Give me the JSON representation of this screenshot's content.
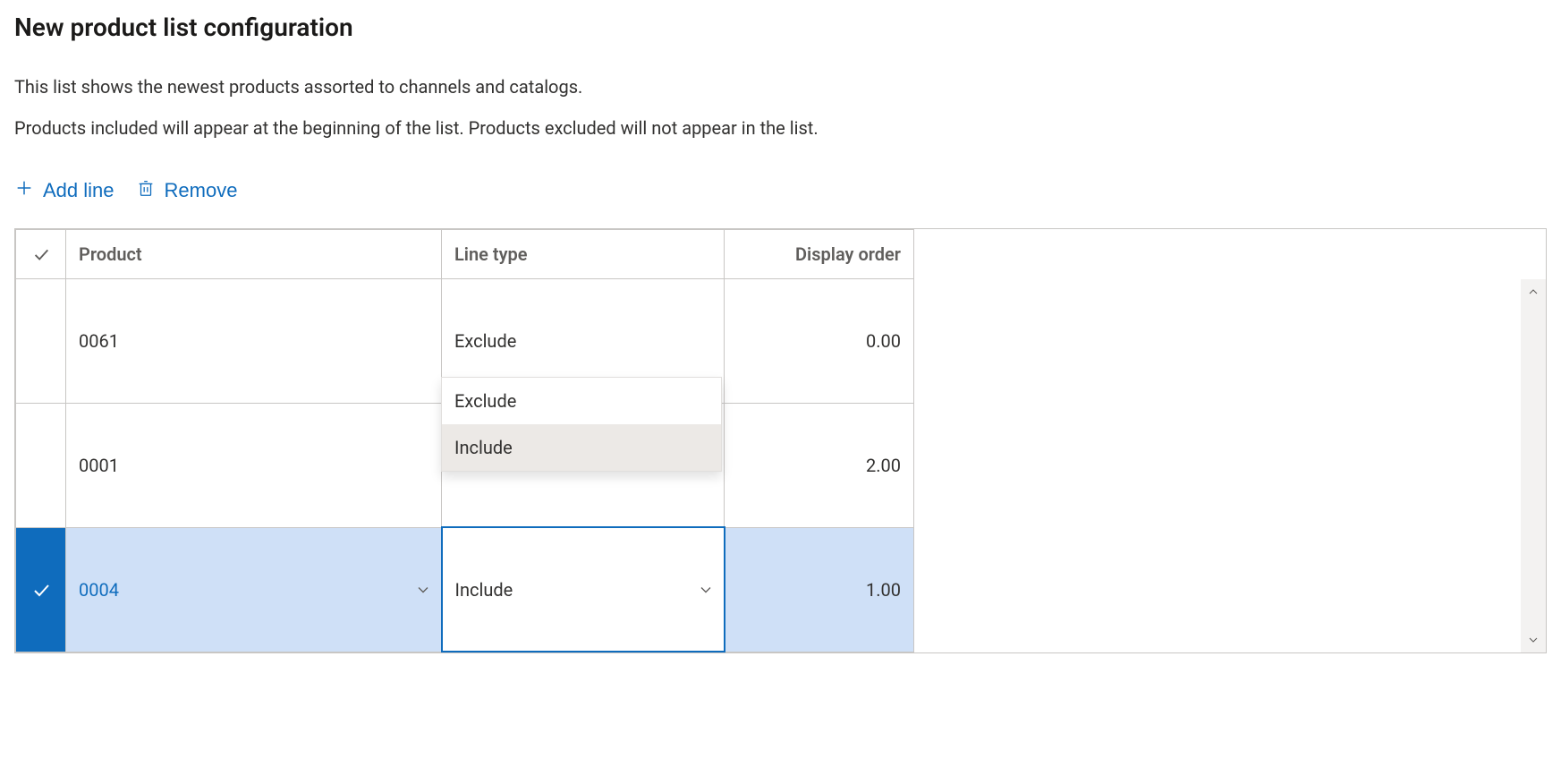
{
  "title": "New product list configuration",
  "description_line1": "This list shows the newest products assorted to channels and catalogs.",
  "description_line2": "Products included will appear at the beginning of the list. Products excluded will not appear in the list.",
  "toolbar": {
    "add_label": "Add line",
    "remove_label": "Remove"
  },
  "columns": {
    "product": "Product",
    "line_type": "Line type",
    "display_order": "Display order"
  },
  "rows": [
    {
      "product": "0061",
      "line_type": "Exclude",
      "display_order": "0.00",
      "selected": false
    },
    {
      "product": "0001",
      "line_type": "Include",
      "display_order": "2.00",
      "selected": false
    },
    {
      "product": "0004",
      "line_type": "Include",
      "display_order": "1.00",
      "selected": true
    }
  ],
  "dropdown": {
    "options": [
      "Exclude",
      "Include"
    ],
    "highlighted": "Include"
  }
}
